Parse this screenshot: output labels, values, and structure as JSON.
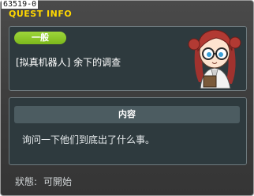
{
  "window": {
    "quest_id": "63519-0",
    "title": "QUEST INFO"
  },
  "quest": {
    "category_badge": "一般",
    "name": "[拟真机器人] 余下的调查",
    "section_title": "内容",
    "description": "询问一下他们到底出了什么事。"
  },
  "status": {
    "label": "狀態:",
    "value": "可開始"
  },
  "colors": {
    "title": "#ffd700",
    "badge": "#8cc82a",
    "panel": "#2e3a3e"
  },
  "icons": {
    "close": "close-icon",
    "npc": "npc-portrait-icon"
  }
}
